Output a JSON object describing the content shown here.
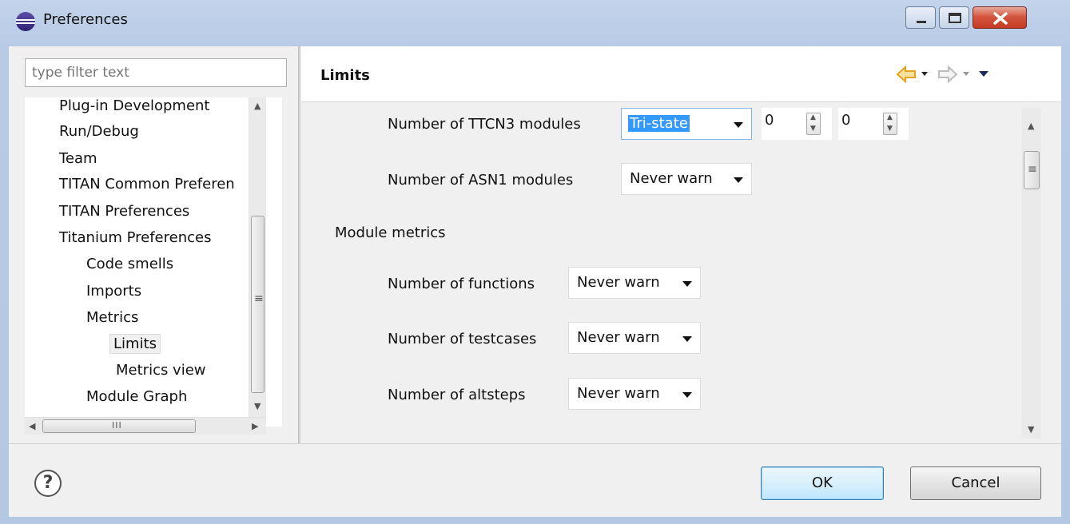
{
  "window": {
    "title": "Preferences",
    "controls": [
      "minimize-icon",
      "maximize-icon",
      "close-icon"
    ]
  },
  "left": {
    "filter_placeholder": "type filter text",
    "tree": [
      {
        "label": "Plug-in Development",
        "level": 0
      },
      {
        "label": "Run/Debug",
        "level": 0
      },
      {
        "label": "Team",
        "level": 0
      },
      {
        "label": "TITAN Common Preferen",
        "level": 0
      },
      {
        "label": "TITAN Preferences",
        "level": 0
      },
      {
        "label": "Titanium Preferences",
        "level": 0
      },
      {
        "label": "Code smells",
        "level": 1
      },
      {
        "label": "Imports",
        "level": 1
      },
      {
        "label": "Metrics",
        "level": 1
      },
      {
        "label": "Limits",
        "level": 2,
        "selected": true
      },
      {
        "label": "Metrics view",
        "level": 2
      },
      {
        "label": "Module Graph",
        "level": 1
      }
    ],
    "hscroll_glyph": "III",
    "vscroll_glyph": "≡"
  },
  "right": {
    "title": "Limits",
    "nav_icons": [
      "back-arrow-icon",
      "dropdown-icon",
      "forward-arrow-icon",
      "dropdown-icon",
      "view-menu-icon"
    ],
    "rows": [
      {
        "label": "Number of TTCN3 modules",
        "combo": "Tri-state",
        "spin1": "0",
        "spin2": "0"
      },
      {
        "label": "Number of ASN1 modules",
        "combo": "Never warn"
      }
    ],
    "section": "Module metrics",
    "module_rows": [
      {
        "label": "Number of functions",
        "combo": "Never warn"
      },
      {
        "label": "Number of testcases",
        "combo": "Never warn"
      },
      {
        "label": "Number of altsteps",
        "combo": "Never warn"
      }
    ],
    "scroll_glyph": "≡"
  },
  "buttons": {
    "help": "?",
    "ok": "OK",
    "cancel": "Cancel"
  },
  "colors": {
    "selection": "#3399ff",
    "accent_arrow": "#e8a31b",
    "close_button": "#c43a22"
  }
}
